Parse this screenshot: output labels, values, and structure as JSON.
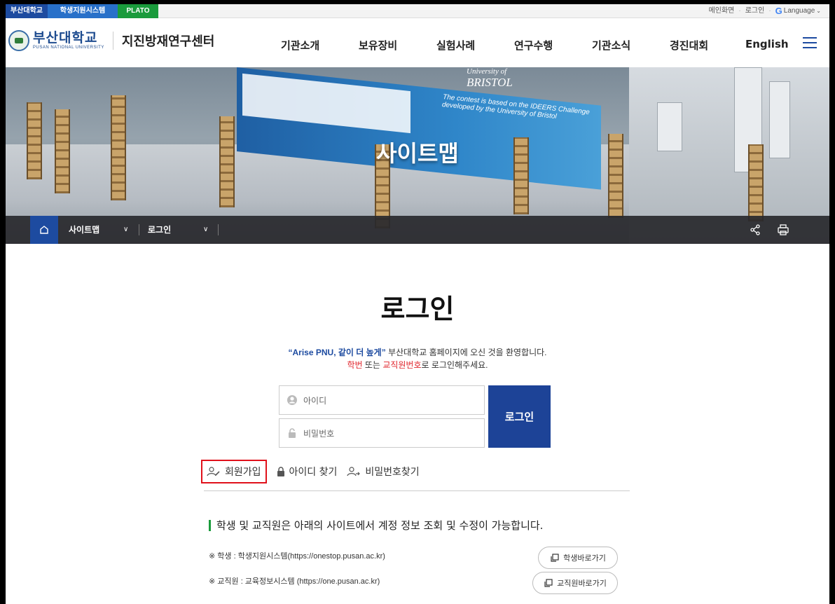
{
  "utility": {
    "quick_links": [
      "부산대학교",
      "학생지원시스템",
      "PLATO"
    ],
    "main_label": "메인화면",
    "login_label": "로그인",
    "language_label": "Language"
  },
  "header": {
    "logo_kr": "부산대학교",
    "logo_en": "PUSAN NATIONAL UNIVERSITY",
    "center_name": "지진방재연구센터",
    "nav": [
      "기관소개",
      "보유장비",
      "실험사례",
      "연구수행",
      "기관소식",
      "경진대회",
      "English"
    ]
  },
  "banner": {
    "title": "사이트맵",
    "bristol_top": "University of",
    "bristol_name": "BRISTOL",
    "contest_line1": "The contest is based on the IDEERS Challenge",
    "contest_line2": "developed by the University of Bristol"
  },
  "breadcrumb": {
    "item1": "사이트맵",
    "item2": "로그인"
  },
  "login": {
    "heading": "로그인",
    "slogan": "“Arise PNU, 같이 더 높게”",
    "welcome_rest": " 부산대학교 홈페이지에 오신 것을 환영합니다.",
    "guide_student": "학번",
    "guide_or": " 또는 ",
    "guide_staff": "교직원번호",
    "guide_rest": "로 로그인해주세요.",
    "id_placeholder": "아이디",
    "pw_placeholder": "비밀번호",
    "button": "로그인"
  },
  "links": {
    "signup": "회원가입",
    "find_id": "아이디 찾기",
    "find_pw": "비밀번호찾기"
  },
  "info": {
    "title": "학생 및 교직원은 아래의 사이트에서 계정 정보 조회 및 수정이 가능합니다.",
    "student_note": "※ 학생 : 학생지원시스템(https://onestop.pusan.ac.kr)",
    "student_button": "학생바로가기",
    "staff_note": "※ 교직원 : 교육정보시스템 (https://one.pusan.ac.kr)",
    "staff_button": "교직원바로가기"
  },
  "colors": {
    "brand_blue": "#1d4ba0",
    "login_button": "#1d4397",
    "highlight_red": "#e0242b",
    "accent_green": "#1a9b3c"
  }
}
